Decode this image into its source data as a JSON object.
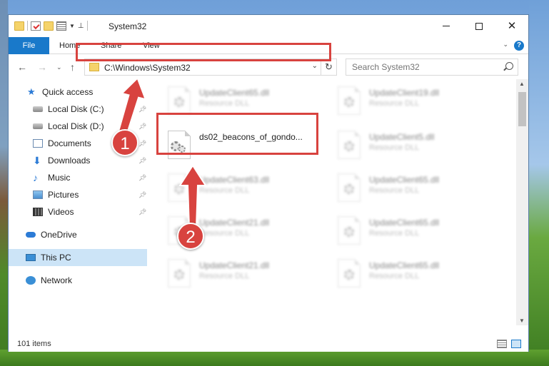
{
  "window": {
    "title": "System32",
    "controls": {
      "minimize": "minimize",
      "maximize": "maximize",
      "close": "✕"
    }
  },
  "ribbon": {
    "tabs": [
      {
        "label": "File"
      },
      {
        "label": "Home"
      },
      {
        "label": "Share"
      },
      {
        "label": "View"
      }
    ],
    "help_label": "?"
  },
  "address": {
    "path": "C:\\Windows\\System32",
    "refresh_glyph": "↻"
  },
  "search": {
    "placeholder": "Search System32"
  },
  "sidebar": {
    "items": [
      {
        "label": "Quick access",
        "icon": "star-icon",
        "pinned": false
      },
      {
        "label": "Local Disk (C:)",
        "icon": "disk-icon",
        "pinned": true
      },
      {
        "label": "Local Disk (D:)",
        "icon": "disk-icon",
        "pinned": true
      },
      {
        "label": "Documents",
        "icon": "document-icon",
        "pinned": true
      },
      {
        "label": "Downloads",
        "icon": "download-icon",
        "pinned": true
      },
      {
        "label": "Music",
        "icon": "music-icon",
        "pinned": true
      },
      {
        "label": "Pictures",
        "icon": "picture-icon",
        "pinned": true
      },
      {
        "label": "Videos",
        "icon": "video-icon",
        "pinned": true
      },
      {
        "label": "OneDrive",
        "icon": "cloud-icon",
        "pinned": false
      },
      {
        "label": "This PC",
        "icon": "computer-icon",
        "pinned": false,
        "selected": true
      },
      {
        "label": "Network",
        "icon": "network-icon",
        "pinned": false
      }
    ]
  },
  "files": {
    "highlighted": {
      "name": "ds02_beacons_of_gondo...",
      "type": ""
    },
    "items": [
      {
        "name": "UpdateClient65.dll",
        "type": "Resource DLL"
      },
      {
        "name": "UpdateClient19.dll",
        "type": "Resource DLL"
      },
      {
        "name": "UpdateClient5.dll",
        "type": "Resource DLL"
      },
      {
        "name": "UpdateClient63.dll",
        "type": "Resource DLL"
      },
      {
        "name": "UpdateClient65.dll",
        "type": "Resource DLL"
      },
      {
        "name": "UpdateClient21.dll",
        "type": "Resource DLL"
      },
      {
        "name": "UpdateClient65.dll",
        "type": "Resource DLL"
      },
      {
        "name": "UpdateClient21.dll",
        "type": "Resource DLL"
      },
      {
        "name": "UpdateClient65.dll",
        "type": "Resource DLL"
      }
    ]
  },
  "status": {
    "item_count": "101 items"
  },
  "annotations": {
    "step1": "1",
    "step2": "2",
    "color": "#d8433f"
  }
}
